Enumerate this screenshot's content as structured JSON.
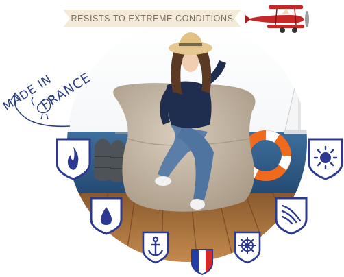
{
  "banner": {
    "text": "RESISTS TO EXTREME CONDITIONS"
  },
  "badge": {
    "line1": "MADE IN",
    "line2": "FRANCE"
  },
  "colors": {
    "shield_navy": "#2b3990",
    "banner_bg": "#f3ead8",
    "plane_red": "#c62828",
    "flag_blue": "#1f3fa8",
    "flag_red": "#d62828"
  },
  "icons": [
    "fire-shield-icon",
    "water-drop-shield-icon",
    "anchor-shield-icon",
    "france-flag-shield-icon",
    "ship-wheel-shield-icon",
    "wind-shield-icon",
    "sun-shield-icon"
  ]
}
